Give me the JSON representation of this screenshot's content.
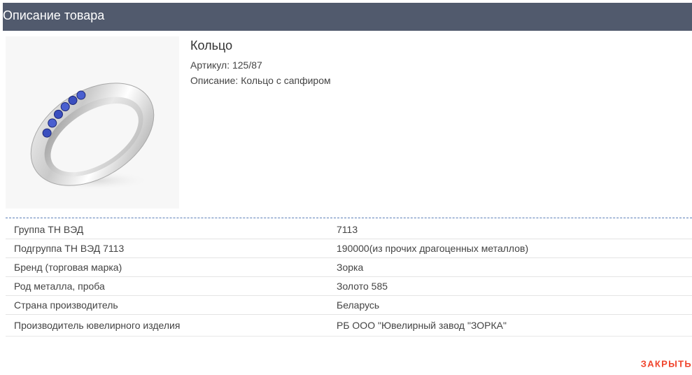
{
  "dialog": {
    "title": "Описание товара"
  },
  "product": {
    "name": "Кольцо",
    "article": "Артикул: 125/87",
    "description": "Описание: Кольцо с сапфиром",
    "image_icon": "ring-icon",
    "stone_color": "#3b4fbf"
  },
  "properties": [
    {
      "label": "Группа ТН ВЭД",
      "value": "7113"
    },
    {
      "label": "Подгруппа ТН ВЭД 7113",
      "value": "190000(из прочих драгоценных металлов)"
    },
    {
      "label": "Бренд (торговая марка)",
      "value": "Зорка"
    },
    {
      "label": "Род металла, проба",
      "value": "Золото 585"
    },
    {
      "label": "Страна производитель",
      "value": "Беларусь"
    },
    {
      "label": "Производитель ювелирного изделия",
      "value": "РБ ООО \"Ювелирный завод \"ЗОРКА\""
    }
  ],
  "actions": {
    "close_label": "ЗАКРЫТЬ"
  },
  "colors": {
    "header_bg": "#515a6d",
    "close_accent": "#f0442c",
    "separator": "#5b7fb8"
  }
}
